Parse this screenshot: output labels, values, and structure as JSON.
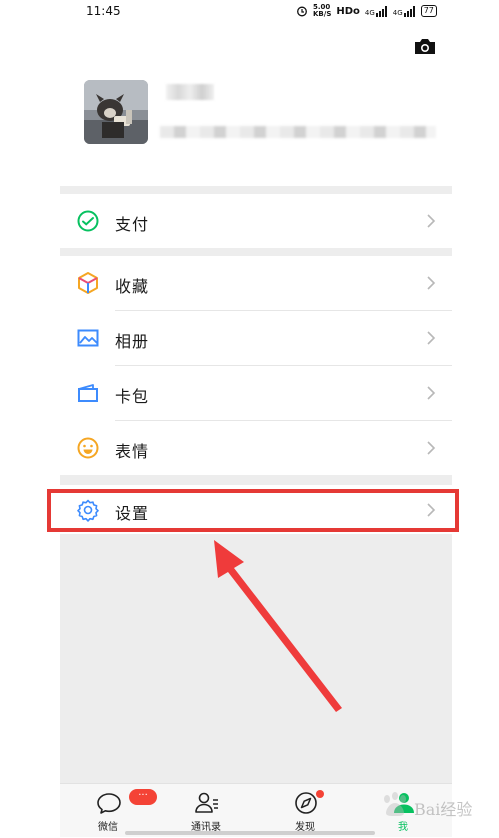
{
  "status_bar": {
    "time": "11:45",
    "speed_value": "5.00",
    "speed_unit": "KB/S",
    "hd_label": "HDo",
    "signal_1": "4G",
    "signal_2": "4G",
    "battery": "77"
  },
  "menu": {
    "pay": "支付",
    "favorites": "收藏",
    "album": "相册",
    "cards": "卡包",
    "stickers": "表情",
    "settings": "设置"
  },
  "tabbar": {
    "chats": "微信",
    "chats_badge": "···",
    "contacts": "通讯录",
    "discover": "发现",
    "me": "我"
  },
  "watermark": "Bai经验",
  "colors": {
    "accent_green": "#07c160",
    "highlight_red": "#e53935",
    "background": "#ededed"
  }
}
